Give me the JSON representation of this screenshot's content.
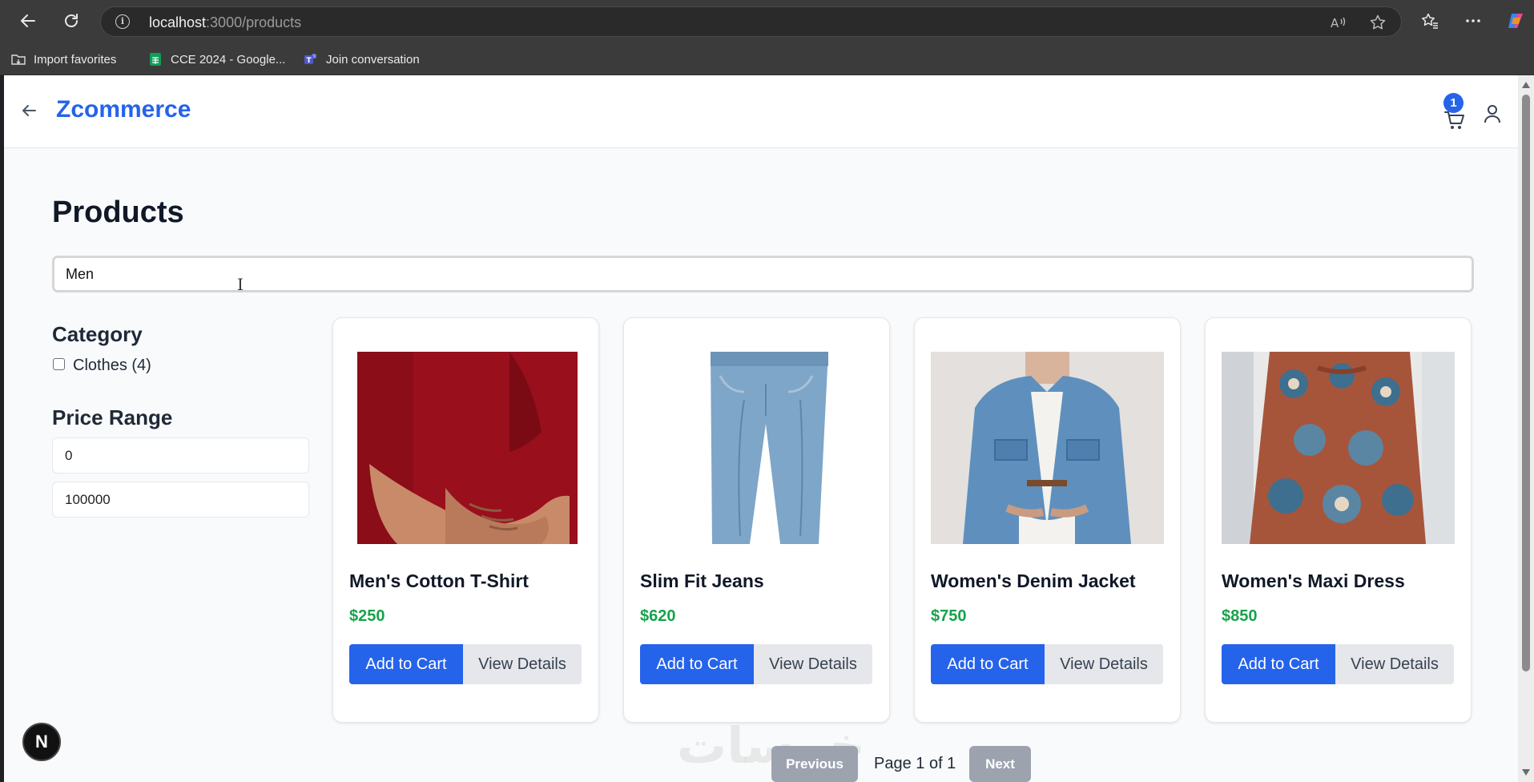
{
  "browser": {
    "url_host": "localhost",
    "url_path": ":3000/products",
    "favorites": [
      {
        "label": "Import favorites",
        "icon": "folder-import-icon"
      },
      {
        "label": "CCE 2024 - Google...",
        "icon": "google-sheets-icon"
      },
      {
        "label": "Join conversation",
        "icon": "teams-icon"
      }
    ]
  },
  "header": {
    "brand": "Zcommerce",
    "cart_count": "1"
  },
  "page": {
    "title": "Products",
    "search_value": "Men"
  },
  "filters": {
    "category_heading": "Category",
    "category_option": "Clothes (4)",
    "price_heading": "Price Range",
    "price_min": "0",
    "price_max": "100000"
  },
  "products": [
    {
      "name": "Men's Cotton T-Shirt",
      "price": "$250",
      "add_label": "Add to Cart",
      "view_label": "View Details"
    },
    {
      "name": "Slim Fit Jeans",
      "price": "$620",
      "add_label": "Add to Cart",
      "view_label": "View Details"
    },
    {
      "name": "Women's Denim Jacket",
      "price": "$750",
      "add_label": "Add to Cart",
      "view_label": "View Details"
    },
    {
      "name": "Women's Maxi Dress",
      "price": "$850",
      "add_label": "Add to Cart",
      "view_label": "View Details"
    }
  ],
  "pagination": {
    "prev_label": "Previous",
    "page_text": "Page 1 of 1",
    "next_label": "Next"
  },
  "dev_badge": "N",
  "watermark": "خمسات",
  "colors": {
    "brand": "#2563eb",
    "price": "#16a34a",
    "button_primary": "#2563eb",
    "button_secondary": "#e5e7eb"
  }
}
